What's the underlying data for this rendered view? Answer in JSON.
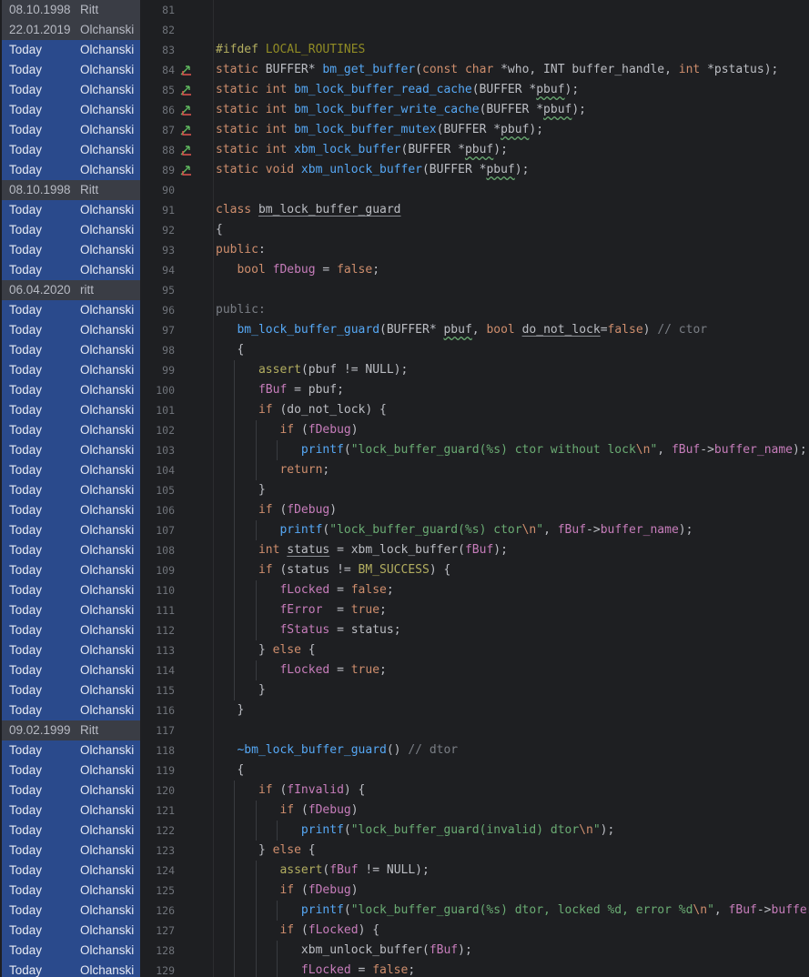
{
  "editor": {
    "colors": {
      "background": "#1e1f22",
      "blame_today": "#2a4a8c",
      "blame_old": "#3a3d45",
      "line_number": "#6f737a",
      "keyword": "#cf8e6d",
      "function": "#56a8f5",
      "string": "#6aab73",
      "comment": "#7a7e85",
      "field": "#c77dbb",
      "macro": "#b3ae60"
    },
    "gutter_icon": "implementation-arrows-icon",
    "lines": [
      {
        "num": "81",
        "date": "08.10.1998",
        "author": "Ritt",
        "old": true,
        "code": []
      },
      {
        "num": "82",
        "date": "22.01.2019",
        "author": "Olchanski",
        "old": true,
        "code": []
      },
      {
        "num": "83",
        "date": "Today",
        "author": "Olchanski",
        "code": [
          {
            "t": "#ifdef ",
            "c": "pp"
          },
          {
            "t": "LOCAL_ROUTINES",
            "c": "ppid"
          }
        ]
      },
      {
        "num": "84",
        "date": "Today",
        "author": "Olchanski",
        "mark": true,
        "code": [
          {
            "t": "static ",
            "c": "kw"
          },
          {
            "t": "BUFFER* "
          },
          {
            "t": "bm_get_buffer",
            "c": "fn"
          },
          {
            "t": "("
          },
          {
            "t": "const char ",
            "c": "kw"
          },
          {
            "t": "*who, INT buffer_handle, "
          },
          {
            "t": "int ",
            "c": "kw"
          },
          {
            "t": "*pstatus);"
          }
        ]
      },
      {
        "num": "85",
        "date": "Today",
        "author": "Olchanski",
        "mark": true,
        "code": [
          {
            "t": "static int ",
            "c": "kw"
          },
          {
            "t": "bm_lock_buffer_read_cache",
            "c": "fn"
          },
          {
            "t": "(BUFFER *"
          },
          {
            "t": "pbuf",
            "c": "typo"
          },
          {
            "t": ");"
          }
        ]
      },
      {
        "num": "86",
        "date": "Today",
        "author": "Olchanski",
        "mark": true,
        "code": [
          {
            "t": "static int ",
            "c": "kw"
          },
          {
            "t": "bm_lock_buffer_write_cache",
            "c": "fn"
          },
          {
            "t": "(BUFFER *"
          },
          {
            "t": "pbuf",
            "c": "typo"
          },
          {
            "t": ");"
          }
        ]
      },
      {
        "num": "87",
        "date": "Today",
        "author": "Olchanski",
        "mark": true,
        "code": [
          {
            "t": "static int ",
            "c": "kw"
          },
          {
            "t": "bm_lock_buffer_mutex",
            "c": "fn"
          },
          {
            "t": "(BUFFER *"
          },
          {
            "t": "pbuf",
            "c": "typo"
          },
          {
            "t": ");"
          }
        ]
      },
      {
        "num": "88",
        "date": "Today",
        "author": "Olchanski",
        "mark": true,
        "code": [
          {
            "t": "static int ",
            "c": "kw"
          },
          {
            "t": "xbm_lock_buffer",
            "c": "fn"
          },
          {
            "t": "(BUFFER *"
          },
          {
            "t": "pbuf",
            "c": "typo"
          },
          {
            "t": ");"
          }
        ]
      },
      {
        "num": "89",
        "date": "Today",
        "author": "Olchanski",
        "mark": true,
        "code": [
          {
            "t": "static void ",
            "c": "kw"
          },
          {
            "t": "xbm_unlock_buffer",
            "c": "fn"
          },
          {
            "t": "(BUFFER *"
          },
          {
            "t": "pbuf",
            "c": "typo"
          },
          {
            "t": ");"
          }
        ]
      },
      {
        "num": "90",
        "date": "08.10.1998",
        "author": "Ritt",
        "old": true,
        "code": []
      },
      {
        "num": "91",
        "date": "Today",
        "author": "Olchanski",
        "code": [
          {
            "t": "class ",
            "c": "kw"
          },
          {
            "t": "bm_lock_buffer_guard",
            "c": "ul"
          }
        ]
      },
      {
        "num": "92",
        "date": "Today",
        "author": "Olchanski",
        "code": [
          {
            "t": "{"
          }
        ]
      },
      {
        "num": "93",
        "date": "Today",
        "author": "Olchanski",
        "code": [
          {
            "t": "public",
            "c": "vis"
          },
          {
            "t": ":"
          }
        ]
      },
      {
        "num": "94",
        "date": "Today",
        "author": "Olchanski",
        "code": [
          {
            "t": "   "
          },
          {
            "t": "bool ",
            "c": "kw"
          },
          {
            "t": "fDebug",
            "c": "fld"
          },
          {
            "t": " = "
          },
          {
            "t": "false",
            "c": "kw"
          },
          {
            "t": ";"
          }
        ]
      },
      {
        "num": "95",
        "date": "06.04.2020",
        "author": "ritt",
        "old": true,
        "code": []
      },
      {
        "num": "96",
        "date": "Today",
        "author": "Olchanski",
        "code": [
          {
            "t": "public:",
            "c": "visdim"
          }
        ]
      },
      {
        "num": "97",
        "date": "Today",
        "author": "Olchanski",
        "code": [
          {
            "t": "   "
          },
          {
            "t": "bm_lock_buffer_guard",
            "c": "fn"
          },
          {
            "t": "(BUFFER* "
          },
          {
            "t": "pbuf",
            "c": "typo"
          },
          {
            "t": ", "
          },
          {
            "t": "bool ",
            "c": "kw"
          },
          {
            "t": "do_not_lock",
            "c": "ul"
          },
          {
            "t": "="
          },
          {
            "t": "false",
            "c": "kw"
          },
          {
            "t": ") "
          },
          {
            "t": "// ctor",
            "c": "cm"
          }
        ]
      },
      {
        "num": "98",
        "date": "Today",
        "author": "Olchanski",
        "code": [
          {
            "t": "   {"
          }
        ]
      },
      {
        "num": "99",
        "date": "Today",
        "author": "Olchanski",
        "code": [
          {
            "t": "      "
          },
          {
            "t": "assert",
            "c": "mac"
          },
          {
            "t": "(pbuf != NULL);"
          }
        ]
      },
      {
        "num": "100",
        "date": "Today",
        "author": "Olchanski",
        "code": [
          {
            "t": "      "
          },
          {
            "t": "fBuf",
            "c": "fld"
          },
          {
            "t": " = pbuf;"
          }
        ]
      },
      {
        "num": "101",
        "date": "Today",
        "author": "Olchanski",
        "code": [
          {
            "t": "      "
          },
          {
            "t": "if ",
            "c": "kw"
          },
          {
            "t": "(do_not_lock) {"
          }
        ]
      },
      {
        "num": "102",
        "date": "Today",
        "author": "Olchanski",
        "code": [
          {
            "t": "         "
          },
          {
            "t": "if ",
            "c": "kw"
          },
          {
            "t": "("
          },
          {
            "t": "fDebug",
            "c": "fld"
          },
          {
            "t": ")"
          }
        ]
      },
      {
        "num": "103",
        "date": "Today",
        "author": "Olchanski",
        "code": [
          {
            "t": "            "
          },
          {
            "t": "printf",
            "c": "fn"
          },
          {
            "t": "("
          },
          {
            "t": "\"lock_buffer_guard(%s) ctor without lock",
            "c": "str"
          },
          {
            "t": "\\n",
            "c": "esc"
          },
          {
            "t": "\"",
            "c": "str"
          },
          {
            "t": ", "
          },
          {
            "t": "fBuf",
            "c": "fld"
          },
          {
            "t": "->"
          },
          {
            "t": "buffer_name",
            "c": "fld"
          },
          {
            "t": ");"
          }
        ]
      },
      {
        "num": "104",
        "date": "Today",
        "author": "Olchanski",
        "code": [
          {
            "t": "         "
          },
          {
            "t": "return",
            "c": "kw"
          },
          {
            "t": ";"
          }
        ]
      },
      {
        "num": "105",
        "date": "Today",
        "author": "Olchanski",
        "code": [
          {
            "t": "      }"
          }
        ]
      },
      {
        "num": "106",
        "date": "Today",
        "author": "Olchanski",
        "code": [
          {
            "t": "      "
          },
          {
            "t": "if ",
            "c": "kw"
          },
          {
            "t": "("
          },
          {
            "t": "fDebug",
            "c": "fld"
          },
          {
            "t": ")"
          }
        ]
      },
      {
        "num": "107",
        "date": "Today",
        "author": "Olchanski",
        "code": [
          {
            "t": "         "
          },
          {
            "t": "printf",
            "c": "fn"
          },
          {
            "t": "("
          },
          {
            "t": "\"lock_buffer_guard(%s) ctor",
            "c": "str"
          },
          {
            "t": "\\n",
            "c": "esc"
          },
          {
            "t": "\"",
            "c": "str"
          },
          {
            "t": ", "
          },
          {
            "t": "fBuf",
            "c": "fld"
          },
          {
            "t": "->"
          },
          {
            "t": "buffer_name",
            "c": "fld"
          },
          {
            "t": ");"
          }
        ]
      },
      {
        "num": "108",
        "date": "Today",
        "author": "Olchanski",
        "code": [
          {
            "t": "      "
          },
          {
            "t": "int ",
            "c": "kw"
          },
          {
            "t": "status",
            "c": "ul"
          },
          {
            "t": " = xbm_lock_buffer("
          },
          {
            "t": "fBuf",
            "c": "fld"
          },
          {
            "t": ");"
          }
        ]
      },
      {
        "num": "109",
        "date": "Today",
        "author": "Olchanski",
        "code": [
          {
            "t": "      "
          },
          {
            "t": "if ",
            "c": "kw"
          },
          {
            "t": "(status != "
          },
          {
            "t": "BM_SUCCESS",
            "c": "mac"
          },
          {
            "t": ") {"
          }
        ]
      },
      {
        "num": "110",
        "date": "Today",
        "author": "Olchanski",
        "code": [
          {
            "t": "         "
          },
          {
            "t": "fLocked",
            "c": "fld"
          },
          {
            "t": " = "
          },
          {
            "t": "false",
            "c": "kw"
          },
          {
            "t": ";"
          }
        ]
      },
      {
        "num": "111",
        "date": "Today",
        "author": "Olchanski",
        "code": [
          {
            "t": "         "
          },
          {
            "t": "fError",
            "c": "fld"
          },
          {
            "t": "  = "
          },
          {
            "t": "true",
            "c": "kw"
          },
          {
            "t": ";"
          }
        ]
      },
      {
        "num": "112",
        "date": "Today",
        "author": "Olchanski",
        "code": [
          {
            "t": "         "
          },
          {
            "t": "fStatus",
            "c": "fld"
          },
          {
            "t": " = status;"
          }
        ]
      },
      {
        "num": "113",
        "date": "Today",
        "author": "Olchanski",
        "code": [
          {
            "t": "      } "
          },
          {
            "t": "else ",
            "c": "kw"
          },
          {
            "t": "{"
          }
        ]
      },
      {
        "num": "114",
        "date": "Today",
        "author": "Olchanski",
        "code": [
          {
            "t": "         "
          },
          {
            "t": "fLocked",
            "c": "fld"
          },
          {
            "t": " = "
          },
          {
            "t": "true",
            "c": "kw"
          },
          {
            "t": ";"
          }
        ]
      },
      {
        "num": "115",
        "date": "Today",
        "author": "Olchanski",
        "code": [
          {
            "t": "      }"
          }
        ]
      },
      {
        "num": "116",
        "date": "Today",
        "author": "Olchanski",
        "code": [
          {
            "t": "   }"
          }
        ]
      },
      {
        "num": "117",
        "date": "09.02.1999",
        "author": "Ritt",
        "old": true,
        "code": []
      },
      {
        "num": "118",
        "date": "Today",
        "author": "Olchanski",
        "code": [
          {
            "t": "   "
          },
          {
            "t": "~bm_lock_buffer_guard",
            "c": "fn"
          },
          {
            "t": "() "
          },
          {
            "t": "// dtor",
            "c": "cm"
          }
        ]
      },
      {
        "num": "119",
        "date": "Today",
        "author": "Olchanski",
        "code": [
          {
            "t": "   {"
          }
        ]
      },
      {
        "num": "120",
        "date": "Today",
        "author": "Olchanski",
        "code": [
          {
            "t": "      "
          },
          {
            "t": "if ",
            "c": "kw"
          },
          {
            "t": "("
          },
          {
            "t": "fInvalid",
            "c": "fld"
          },
          {
            "t": ") {"
          }
        ]
      },
      {
        "num": "121",
        "date": "Today",
        "author": "Olchanski",
        "code": [
          {
            "t": "         "
          },
          {
            "t": "if ",
            "c": "kw"
          },
          {
            "t": "("
          },
          {
            "t": "fDebug",
            "c": "fld"
          },
          {
            "t": ")"
          }
        ]
      },
      {
        "num": "122",
        "date": "Today",
        "author": "Olchanski",
        "code": [
          {
            "t": "            "
          },
          {
            "t": "printf",
            "c": "fn"
          },
          {
            "t": "("
          },
          {
            "t": "\"lock_buffer_guard(invalid) dtor",
            "c": "str"
          },
          {
            "t": "\\n",
            "c": "esc"
          },
          {
            "t": "\"",
            "c": "str"
          },
          {
            "t": ");"
          }
        ]
      },
      {
        "num": "123",
        "date": "Today",
        "author": "Olchanski",
        "code": [
          {
            "t": "      } "
          },
          {
            "t": "else ",
            "c": "kw"
          },
          {
            "t": "{"
          }
        ]
      },
      {
        "num": "124",
        "date": "Today",
        "author": "Olchanski",
        "code": [
          {
            "t": "         "
          },
          {
            "t": "assert",
            "c": "mac"
          },
          {
            "t": "("
          },
          {
            "t": "fBuf",
            "c": "fld"
          },
          {
            "t": " != NULL);"
          }
        ]
      },
      {
        "num": "125",
        "date": "Today",
        "author": "Olchanski",
        "code": [
          {
            "t": "         "
          },
          {
            "t": "if ",
            "c": "kw"
          },
          {
            "t": "("
          },
          {
            "t": "fDebug",
            "c": "fld"
          },
          {
            "t": ")"
          }
        ]
      },
      {
        "num": "126",
        "date": "Today",
        "author": "Olchanski",
        "code": [
          {
            "t": "            "
          },
          {
            "t": "printf",
            "c": "fn"
          },
          {
            "t": "("
          },
          {
            "t": "\"lock_buffer_guard(%s) dtor, locked %d, error %d",
            "c": "str"
          },
          {
            "t": "\\n",
            "c": "esc"
          },
          {
            "t": "\"",
            "c": "str"
          },
          {
            "t": ", "
          },
          {
            "t": "fBuf",
            "c": "fld"
          },
          {
            "t": "->"
          },
          {
            "t": "buffer",
            "c": "fld"
          }
        ]
      },
      {
        "num": "127",
        "date": "Today",
        "author": "Olchanski",
        "code": [
          {
            "t": "         "
          },
          {
            "t": "if ",
            "c": "kw"
          },
          {
            "t": "("
          },
          {
            "t": "fLocked",
            "c": "fld"
          },
          {
            "t": ") {"
          }
        ]
      },
      {
        "num": "128",
        "date": "Today",
        "author": "Olchanski",
        "code": [
          {
            "t": "            "
          },
          {
            "t": "xbm_unlock_buffer("
          },
          {
            "t": "fBuf",
            "c": "fld"
          },
          {
            "t": ");"
          }
        ]
      },
      {
        "num": "129",
        "date": "Today",
        "author": "Olchanski",
        "code": [
          {
            "t": "            "
          },
          {
            "t": "fLocked",
            "c": "fld"
          },
          {
            "t": " = "
          },
          {
            "t": "false",
            "c": "kw"
          },
          {
            "t": ";"
          }
        ]
      }
    ]
  }
}
